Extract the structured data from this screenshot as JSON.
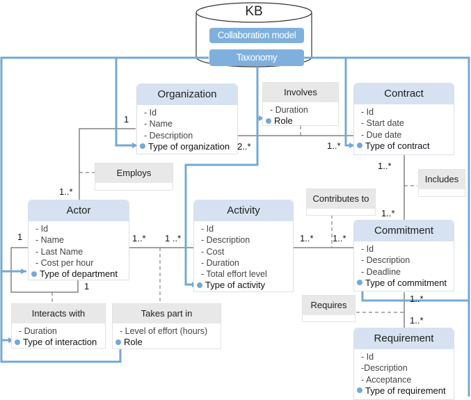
{
  "kb": {
    "title": "KB",
    "items": [
      "Collaboration model",
      "Taxonomy"
    ]
  },
  "classes": {
    "organization": {
      "title": "Organization",
      "attrs": [
        "- Id",
        "- Name",
        "- Description"
      ],
      "key": "Type of organization"
    },
    "contract": {
      "title": "Contract",
      "attrs": [
        "- Id",
        "- Start date",
        "- Due date"
      ],
      "key": "Type of contract"
    },
    "actor": {
      "title": "Actor",
      "attrs": [
        "- Id",
        "- Name",
        "- Last Name",
        "- Cost per hour"
      ],
      "key": "Type of department"
    },
    "activity": {
      "title": "Activity",
      "attrs": [
        "- Id",
        "- Description",
        "- Cost",
        "- Duration",
        "- Total effort level"
      ],
      "key": "Type of activity"
    },
    "commitment": {
      "title": "Commitment",
      "attrs": [
        "- Id",
        "- Description",
        "- Deadline"
      ],
      "key": "Type of commitment"
    },
    "requirement": {
      "title": "Requirement",
      "attrs": [
        "- Id",
        "-Description",
        "- Acceptance"
      ],
      "key": "Type of requirement"
    }
  },
  "associations": {
    "involves": {
      "title": "Involves",
      "attrs": [
        "- Duration"
      ],
      "key": "Role"
    },
    "employs": {
      "title": "Employs"
    },
    "includes": {
      "title": "Includes"
    },
    "contributes": {
      "title": "Contributes to"
    },
    "requires": {
      "title": "Requires"
    },
    "interacts": {
      "title": "Interacts with",
      "attrs": [
        "- Duration"
      ],
      "key": "Type of interaction"
    },
    "takespart": {
      "title": "Takes part in",
      "attrs": [
        "- Level of effort (hours)"
      ],
      "key": "Role"
    }
  },
  "multiplicities": {
    "org_actor_org": "1",
    "org_actor_actor": "1..*",
    "org_contract_org": "2..*",
    "org_contract_contract": "1..*",
    "contract_commit_contract": "1..*",
    "contract_commit_commit": "1..*",
    "actor_activity_actor": "1..*",
    "actor_activity_activity": "1 ..*",
    "activity_commit_activity": "1..*",
    "activity_commit_commit": "1..*",
    "actor_self_a": "1",
    "actor_self_b": "1",
    "commit_req_commit": "1..*",
    "commit_req_req": "1..*"
  },
  "colors": {
    "taxonomy_link": "#74a8d6",
    "class_header": "#d6e2f1",
    "assoc_header": "#e8e8e8",
    "line": "#808080"
  }
}
